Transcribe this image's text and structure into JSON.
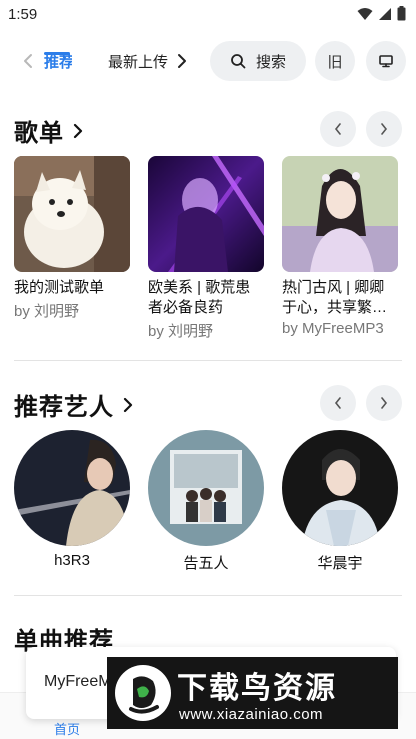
{
  "status_bar": {
    "time": "1:59"
  },
  "nav": {
    "tabs": [
      {
        "label": "推荐",
        "active": true
      },
      {
        "label": "最新上传",
        "active": false
      }
    ],
    "search_label": "搜索",
    "old_label": "旧"
  },
  "sections": {
    "playlists": {
      "title": "歌单"
    },
    "artists": {
      "title": "推荐艺人"
    },
    "singles": {
      "title": "单曲推荐"
    }
  },
  "playlists": [
    {
      "title": "我的测试歌单",
      "by": "by 刘明野"
    },
    {
      "title": "欧美系 | 歌荒患者必备良药",
      "by": "by 刘明野"
    },
    {
      "title": "热门古风 | 卿卿于心，共享繁…",
      "by": "by MyFreeMP3"
    }
  ],
  "artists": [
    {
      "name": "h3R3"
    },
    {
      "name": "告五人"
    },
    {
      "name": "华晨宇"
    }
  ],
  "mini_player": {
    "title": "MyFreeMP3"
  },
  "bottom_nav": {
    "home_label": "首页"
  },
  "watermark": {
    "title": "下载鸟资源",
    "url": "www.xiazainiao.com"
  },
  "colors": {
    "accent": "#2b7de9",
    "pill_bg": "#eef0f2",
    "text": "#111111",
    "muted": "#777777"
  }
}
